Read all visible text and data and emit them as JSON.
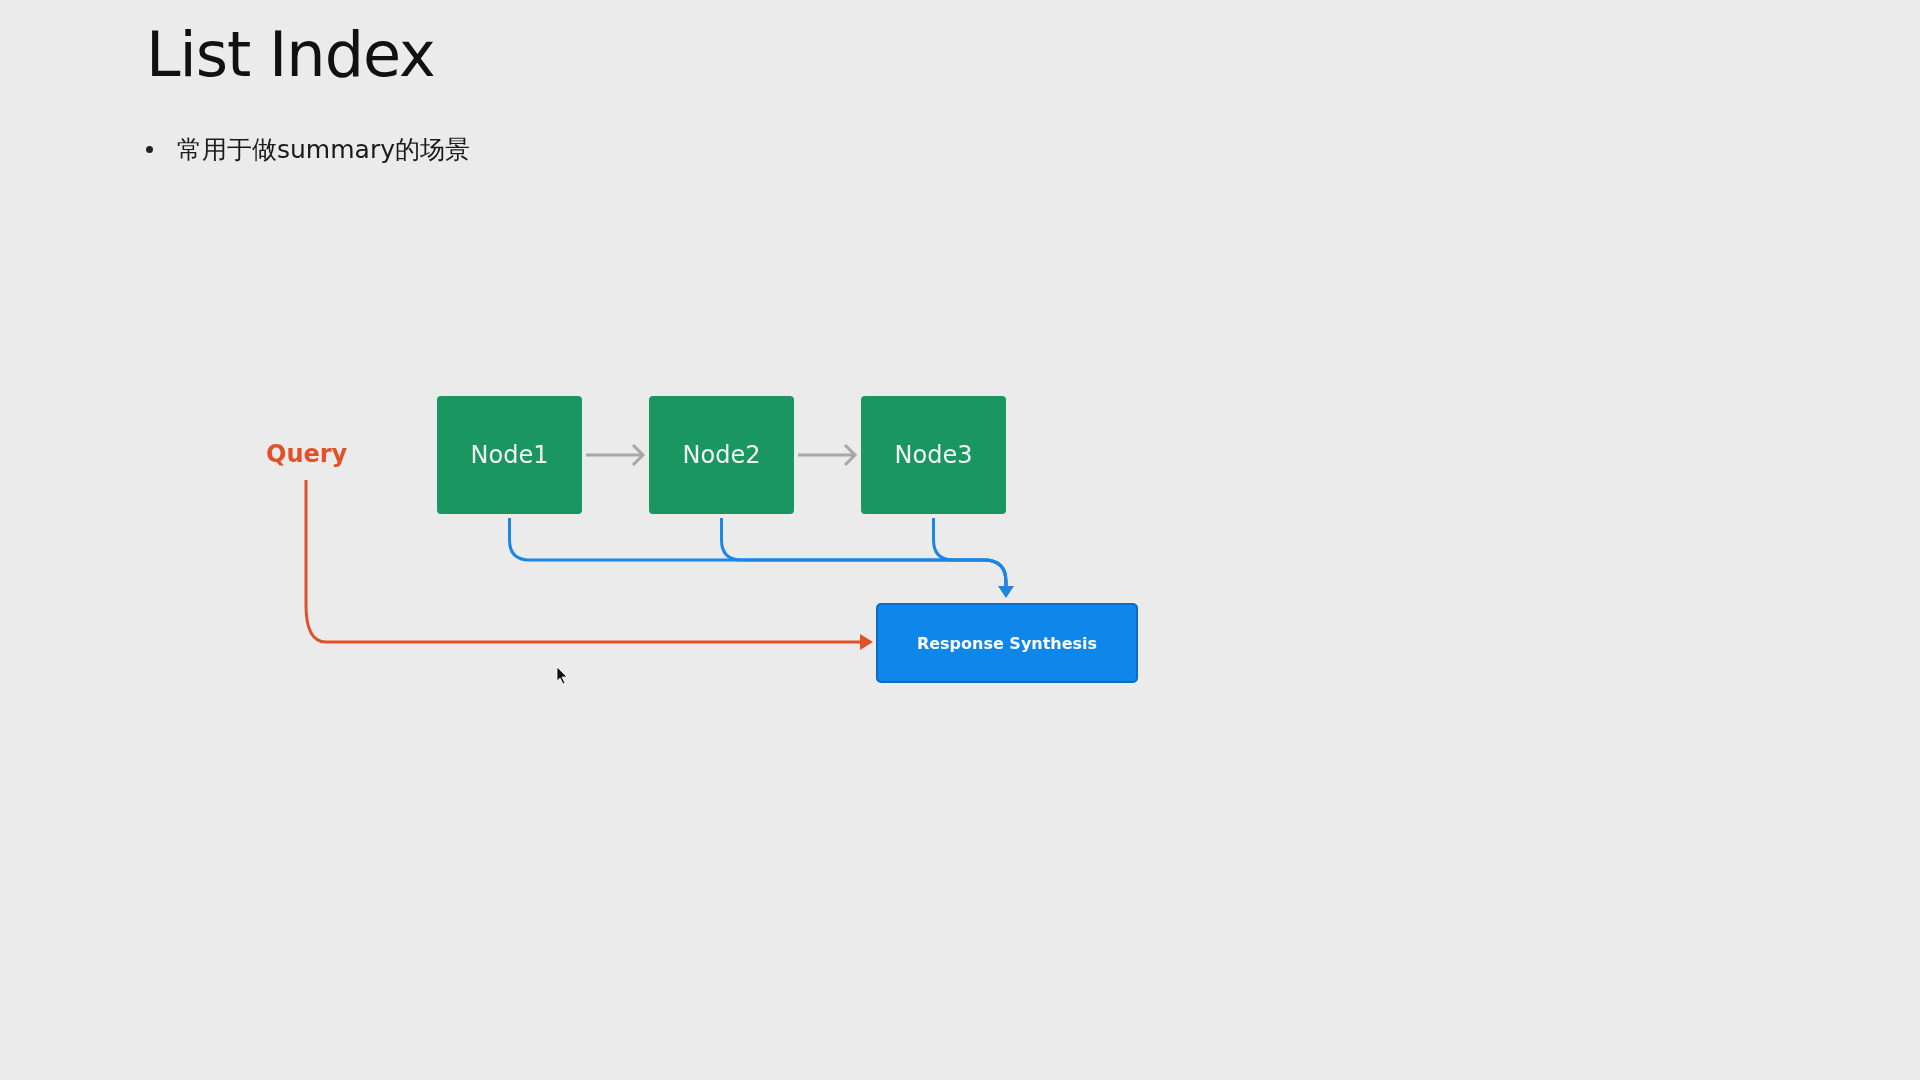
{
  "title": "List Index",
  "bullets": [
    "常用于做summary的场景"
  ],
  "diagram": {
    "query": "Query",
    "nodes": [
      {
        "label": "Node1"
      },
      {
        "label": "Node2"
      },
      {
        "label": "Node3"
      }
    ],
    "synthesis": "Response Synthesis"
  }
}
